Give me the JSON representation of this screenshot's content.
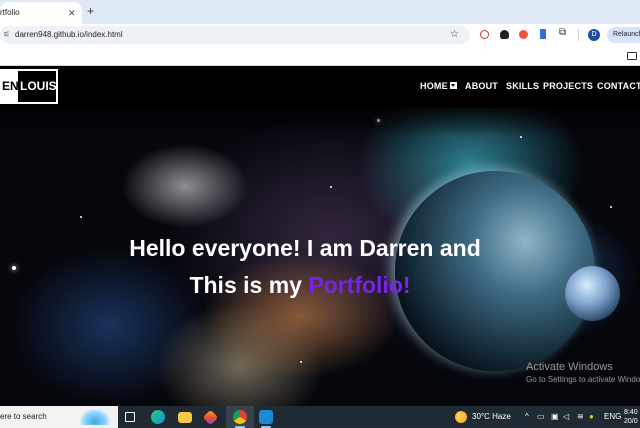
{
  "browser": {
    "tab": {
      "title": "rtfolio",
      "close_glyph": "✕"
    },
    "new_tab_glyph": "+",
    "url": "darren948.github.io/index.html",
    "profile_initial": "D",
    "relaunch_label": "Relaunch"
  },
  "site": {
    "logo": {
      "first": "EN",
      "last": "LOUIS"
    },
    "nav": [
      "HOME",
      "ABOUT",
      "SKILLS",
      "PROJECTS",
      "CONTACT"
    ],
    "hero": {
      "line1": "Hello everyone! I am Darren and",
      "line2_prefix": "This is my ",
      "line2_accent": "Portfolio!"
    },
    "accent_color": "#7a22e6"
  },
  "watermark": {
    "title": "Activate Windows",
    "subtitle": "Go to Settings to activate Windows."
  },
  "taskbar": {
    "search_placeholder": "ere to search",
    "weather": "30°C  Haze",
    "language": "ENG",
    "time": "8:40",
    "date": "20/0"
  }
}
